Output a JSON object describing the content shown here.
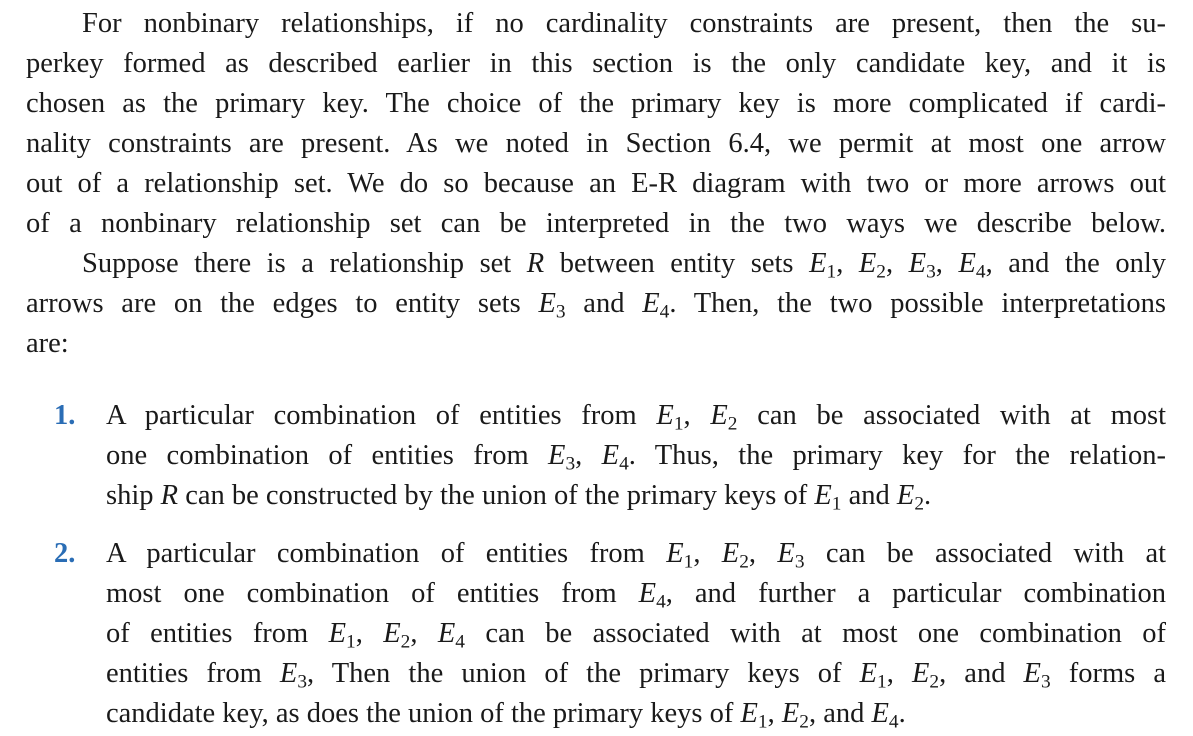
{
  "paragraph1": {
    "lines": [
      "For nonbinary relationships, if no cardinality constraints are present, then the su-",
      "perkey formed as described earlier in this section is the only candidate key, and it is",
      "chosen as the primary key. The choice of the primary key is more complicated if cardi-",
      "nality constraints are present. As we noted in Section 6.4, we permit at most one arrow",
      "out of a relationship set. We do so because an E-R diagram with two or more arrows out",
      "of a nonbinary relationship set can be interpreted in the two ways we describe below."
    ]
  },
  "paragraph2": {
    "l1_a": "Suppose there is a relationship set ",
    "l1_R": "R",
    "l1_b": " between entity sets ",
    "l1_c": ", and the only",
    "l2_a": "arrows are on the edges to entity sets ",
    "l2_and": " and ",
    "l2_b": ". Then, the two possible interpretations",
    "l3": "are:"
  },
  "entities": {
    "E": "E",
    "sub1": "1",
    "sub2": "2",
    "sub3": "3",
    "sub4": "4"
  },
  "list": [
    {
      "number": "1.",
      "l1_a": "A particular combination of entities from ",
      "l1_b": " can be associated with at most",
      "l2_a": "one combination of entities from ",
      "l2_b": ". Thus, the primary key for the relation-",
      "l3_a": "ship ",
      "l3_R": "R",
      "l3_b": " can be constructed by the union of the primary keys of ",
      "l3_and": " and ",
      "l3_end": "."
    },
    {
      "number": "2.",
      "l1_a": "A particular combination of entities from ",
      "l1_b": " can be associated with at",
      "l2_a": "most one combination of entities from ",
      "l2_b": ", and further a particular combination",
      "l3_a": "of entities from ",
      "l3_b": " can be associated with at most one combination of",
      "l4_a": "entities from ",
      "l4_b": ", Then the union of the primary keys of ",
      "l4_and": ", and ",
      "l4_c": " forms a",
      "l5_a": "candidate key, as does the union of the primary keys of ",
      "l5_and": ", and ",
      "l5_end": "."
    }
  ]
}
